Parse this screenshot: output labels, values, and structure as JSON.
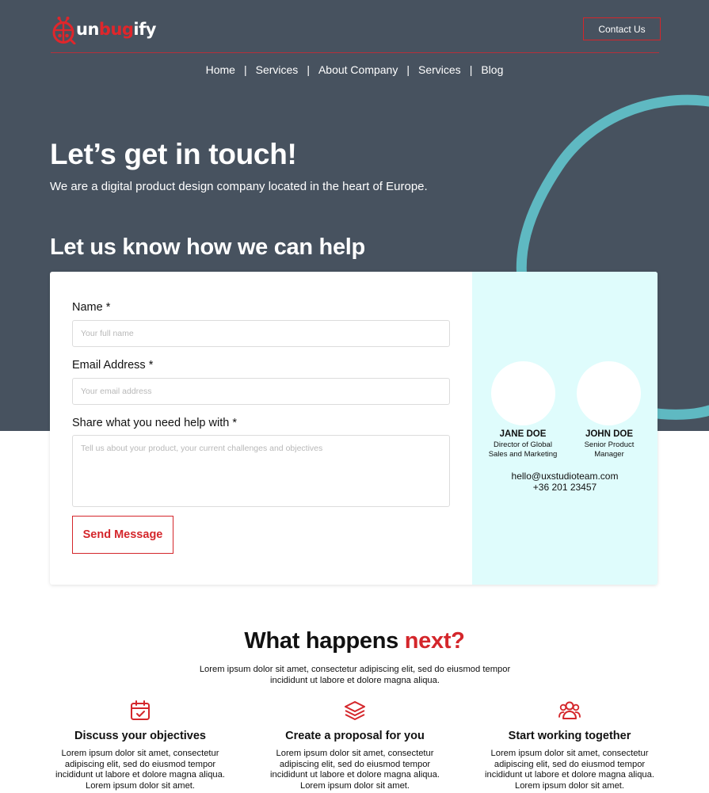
{
  "brand": {
    "logo_parts": [
      "un",
      "bug",
      "ify"
    ],
    "accent_color": "#d4262b",
    "header_bg": "#47525f",
    "swirl_color": "#5fb9c2",
    "team_bg": "#dffcfc"
  },
  "header": {
    "contact_label": "Contact Us"
  },
  "nav": {
    "items": [
      "Home",
      "Services",
      "About Company",
      "Services",
      "Blog"
    ],
    "separator": "|"
  },
  "hero": {
    "title": "Let’s get in touch!",
    "subtitle": "We are a digital product design company located in the heart of Europe.",
    "help_title": "Let us know how we can help"
  },
  "form": {
    "name_label": "Name *",
    "name_placeholder": "Your full name",
    "email_label": "Email Address *",
    "email_placeholder": "Your email address",
    "message_label": "Share what you need help with *",
    "message_placeholder": "Tell us about your product, your current challenges and objectives",
    "submit_label": "Send Message"
  },
  "team": {
    "members": [
      {
        "name": "JANE DOE",
        "role_line1": "Director of Global",
        "role_line2": "Sales and Marketing"
      },
      {
        "name": "JOHN DOE",
        "role_line1": "Senior Product",
        "role_line2": "Manager"
      }
    ],
    "email": "hello@uxstudioteam.com",
    "phone": "+36 201 23457"
  },
  "next": {
    "title_main": "What happens ",
    "title_accent": "next?",
    "subtitle_line1": "Lorem ipsum dolor sit amet, consectetur adipiscing elit, sed do eiusmod tempor",
    "subtitle_line2": "incididunt ut labore et dolore magna aliqua.",
    "steps": [
      {
        "icon": "calendar-check-icon",
        "title": "Discuss your objectives",
        "line1": "Lorem ipsum dolor sit amet, consectetur",
        "line2": "adipiscing elit, sed do eiusmod tempor",
        "line3": "incididunt ut labore et dolore magna aliqua.",
        "line4": "Lorem ipsum dolor sit amet."
      },
      {
        "icon": "layers-icon",
        "title": "Create a proposal for you",
        "line1": "Lorem ipsum dolor sit amet, consectetur",
        "line2": "adipiscing elit, sed do eiusmod tempor",
        "line3": "incididunt ut labore et dolore magna aliqua.",
        "line4": "Lorem ipsum dolor sit amet."
      },
      {
        "icon": "users-icon",
        "title": "Start working together",
        "line1": "Lorem ipsum dolor sit amet, consectetur",
        "line2": "adipiscing elit, sed do eiusmod tempor",
        "line3": "incididunt ut labore et dolore magna aliqua.",
        "line4": "Lorem ipsum dolor sit amet."
      }
    ]
  }
}
